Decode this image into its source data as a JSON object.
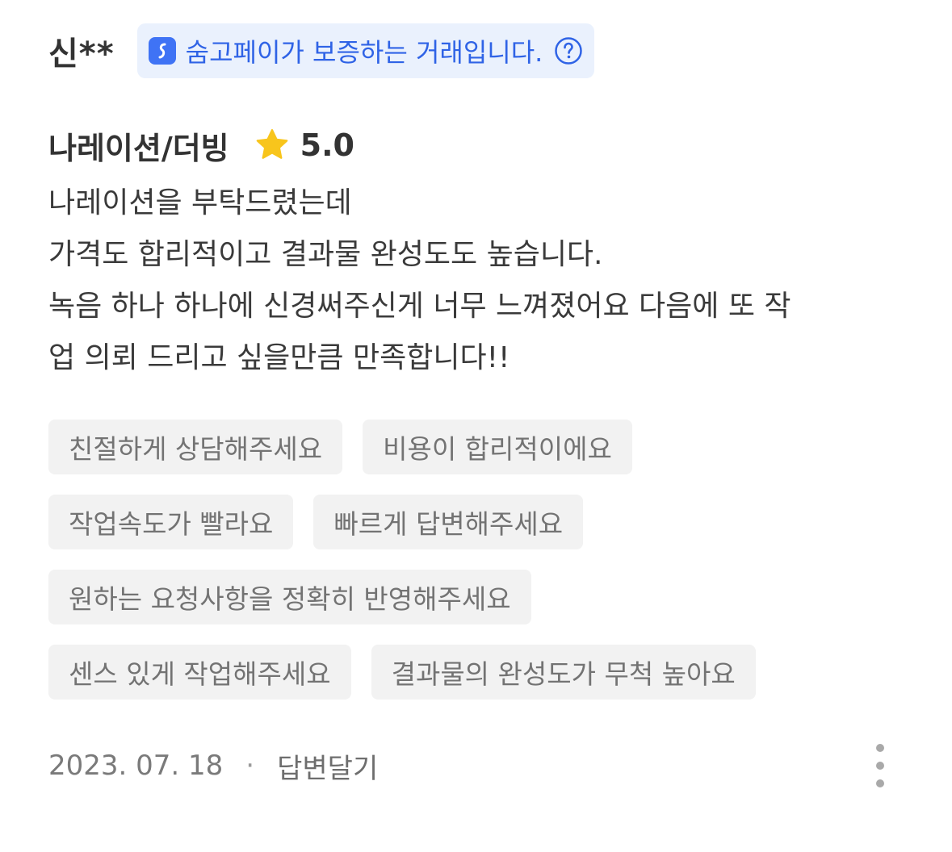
{
  "review": {
    "reviewer_name": "신**",
    "guarantee_text": "숨고페이가 보증하는 거래입니다.",
    "service_name": "나레이션/더빙",
    "rating": "5.0",
    "body_lines": [
      "나레이션을 부탁드렸는데",
      "가격도 합리적이고 결과물 완성도도 높습니다.",
      "녹음 하나 하나에 신경써주신게 너무 느껴졌어요 다음에 또 작",
      "업 의뢰 드리고 싶을만큼 만족합니다!!"
    ],
    "tags": [
      [
        "친절하게 상담해주세요",
        "비용이 합리적이에요"
      ],
      [
        "작업속도가 빨라요",
        "빠르게 답변해주세요"
      ],
      [
        "원하는 요청사항을 정확히 반영해주세요"
      ],
      [
        "센스 있게 작업해주세요",
        "결과물의 완성도가 무척 높아요"
      ]
    ],
    "date": "2023. 07. 18",
    "separator": "·",
    "reply_label": "답변달기"
  },
  "icons": {
    "pay": "soomgo-pay-icon",
    "help": "question-circle-icon",
    "star": "star-icon",
    "more": "more-vertical-icon"
  },
  "colors": {
    "accent_blue": "#3f73f5",
    "guarantee_bg": "#eaf1fd",
    "star_yellow": "#f8c51c",
    "tag_bg": "#f2f2f2"
  }
}
